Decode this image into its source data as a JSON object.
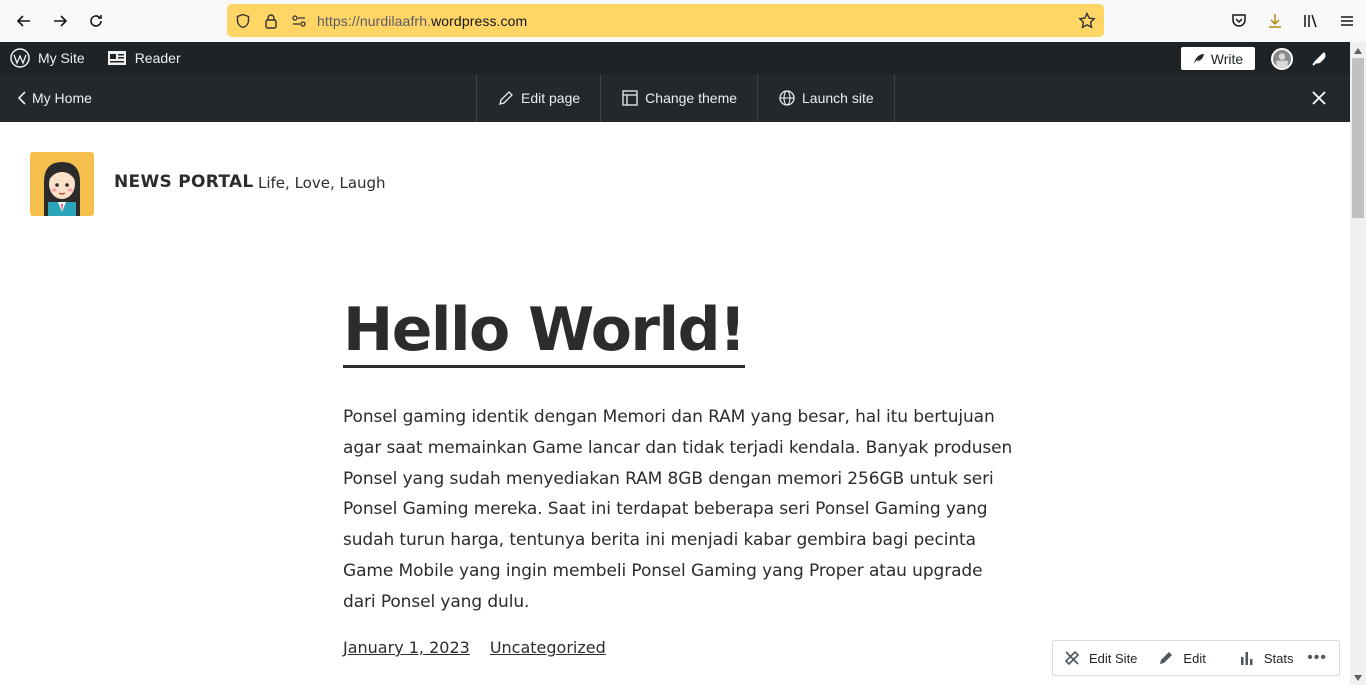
{
  "browser": {
    "url_prefix": "https://",
    "url_host_sub": "nurdilaafrh.",
    "url_host": "wordpress.com"
  },
  "admin_bar": {
    "my_site": "My Site",
    "reader": "Reader",
    "write": "Write"
  },
  "site_bar": {
    "my_home": "My Home",
    "edit_page": "Edit page",
    "change_theme": "Change theme",
    "launch_site": "Launch site"
  },
  "site": {
    "title": "NEWS PORTAL",
    "tagline": "Life, Love, Laugh"
  },
  "post": {
    "title": "Hello World!",
    "body": "Ponsel gaming identik dengan Memori dan RAM yang besar, hal itu bertujuan agar saat memainkan Game lancar dan tidak terjadi kendala. Banyak produsen Ponsel yang sudah menyediakan RAM 8GB dengan memori 256GB untuk seri Ponsel Gaming mereka. Saat ini terdapat beberapa seri Ponsel Gaming yang sudah turun harga, tentunya berita ini menjadi kabar gembira bagi pecinta Game Mobile yang ingin membeli Ponsel Gaming yang Proper atau upgrade dari Ponsel yang dulu.",
    "date": "January 1, 2023",
    "category": "Uncategorized"
  },
  "float_bar": {
    "edit_site": "Edit Site",
    "edit": "Edit",
    "stats": "Stats",
    "more": "•••"
  },
  "colors": {
    "url_bar": "#ffd666",
    "admin_bar": "#1d2327",
    "site_bar": "#23282d",
    "logo_bg": "#f5c04b"
  }
}
